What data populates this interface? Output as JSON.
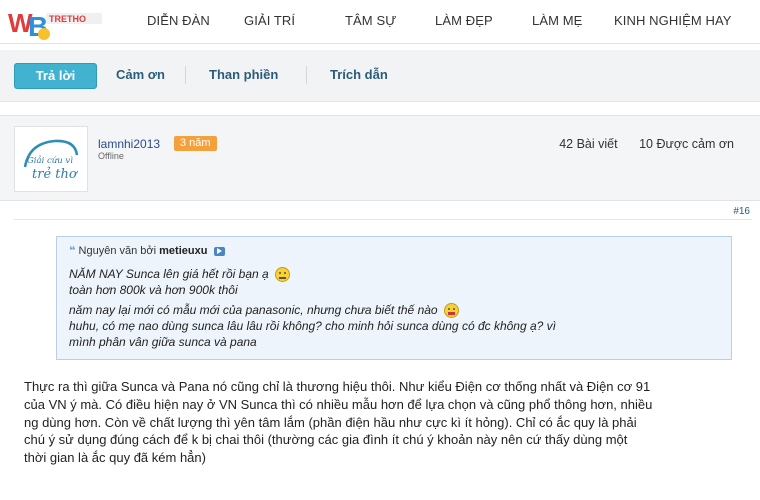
{
  "logo": {
    "text": "WT WEBTRETHO",
    "icon": "webtretho-logo"
  },
  "nav": [
    "DIỄN ĐÀN",
    "GIẢI TRÍ",
    "TÂM SỰ",
    "LÀM ĐẸP",
    "LÀM MẸ",
    "KINH NGHIỆM HAY"
  ],
  "actions": {
    "reply": "Trả lời",
    "thanks": "Cảm ơn",
    "complain": "Than phiền",
    "quote": "Trích dẫn"
  },
  "post": {
    "avatar_text": "Giải cứu vì trẻ thơ",
    "username": "lamnhi2013",
    "badge": "3 năm",
    "status": "Offline",
    "posts": "42 Bài viết",
    "thanks": "10 Được cảm ơn",
    "number": "#16",
    "quote": {
      "header_prefix": "Nguyên văn bởi",
      "author": "metieuxu",
      "lines": [
        "NĂM NAY Sunca lên giá hết rồi bạn ạ",
        "toàn hơn 800k và hơn 900k thôi",
        "năm nay lại mới có mẫu mới của panasonic, nhưng chưa biết thế nào",
        "huhu, có mẹ nao dùng sunca lâu lâu rồi không? cho minh hỏi sunca dùng có đc không ạ? vì",
        "mình phân vân giữa sunca và pana"
      ]
    },
    "body_lines": [
      "Thực ra thì giữa Sunca và Pana nó cũng chỉ là thương hiệu thôi. Như kiểu Điện cơ thống nhất và Điện cơ 91",
      "của VN ý mà. Có điều hiện nay ở VN Sunca thì có nhiều mẫu hơn để lựa chọn và cũng phổ thông hơn, nhiều",
      "ng dùng hơn. Còn về chất lượng thì yên tâm lắm (phần điện hầu như cực kì ít hỏng). Chỉ có ắc quy là phải",
      "chú ý sử dụng đúng cách để k bị chai thôi (thường các gia đình ít chú ý khoản này nên cứ thấy dùng một",
      "thời gian là ắc quy đã kém hẳn)"
    ]
  },
  "colors": {
    "primary_button": "#41b3d1",
    "link": "#2b5c7a",
    "badge": "#f4a13b",
    "quote_bg": "#eef4fb"
  }
}
